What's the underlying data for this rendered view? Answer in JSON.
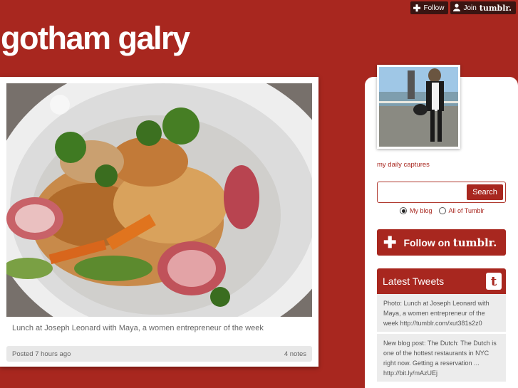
{
  "topbar": {
    "follow_label": "Follow",
    "join_label": "Join",
    "join_brand": "tumblr."
  },
  "blog": {
    "title": "gotham galry"
  },
  "post": {
    "caption": "Lunch at Joseph Leonard with Maya, a women entrepreneur of the week",
    "posted": "Posted 7 hours ago",
    "notes": "4 notes"
  },
  "sidebar": {
    "description": "my daily captures",
    "search": {
      "value": "",
      "placeholder": "",
      "button": "Search"
    },
    "radios": {
      "my_blog": "My blog",
      "all": "All of Tumblr",
      "selected": "My blog"
    },
    "follow_button": {
      "text": "Follow on",
      "brand": "tumblr."
    },
    "tweets": {
      "title": "Latest Tweets",
      "items": [
        "Photo: Lunch at Joseph Leonard with Maya, a women entrepreneur of the week http://tumblr.com/xut381s2z0",
        "New blog post: The Dutch: The Dutch is one of the hottest restaurants in NYC right now.  Getting a reservation ... http://bit.ly/mAzUEj"
      ]
    }
  },
  "icons": [
    "plus-icon",
    "user-icon",
    "twitter-icon"
  ]
}
